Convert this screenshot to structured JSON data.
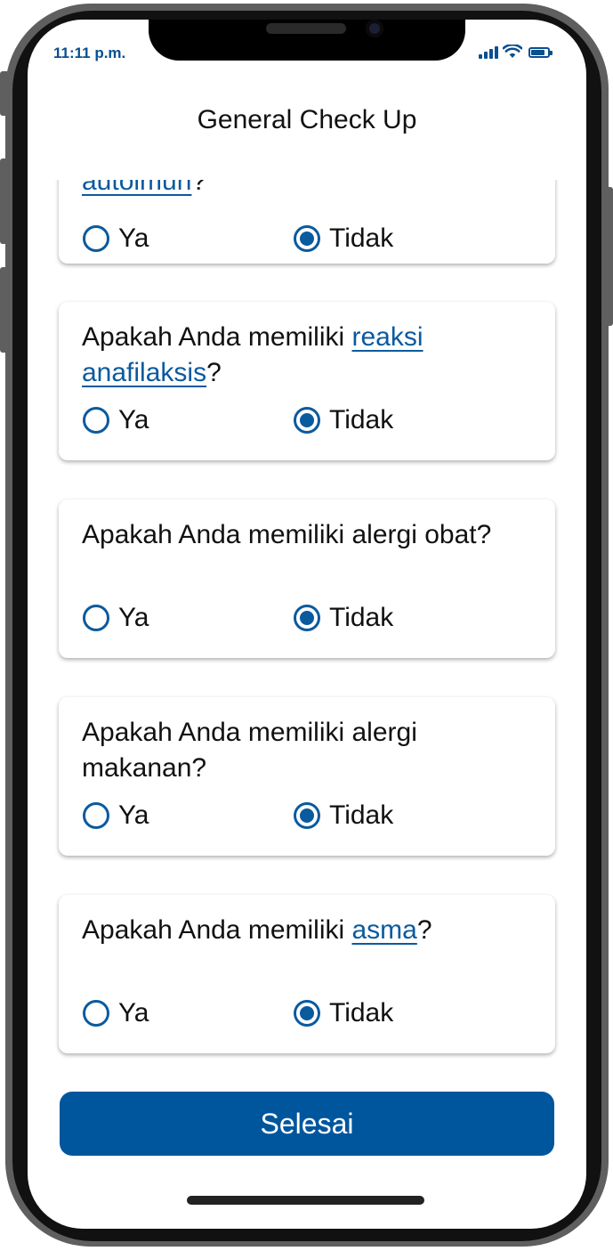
{
  "status_bar": {
    "time": "11:11 p.m.",
    "icons": [
      "cellular-signal-icon",
      "wifi-icon",
      "battery-icon"
    ],
    "color": "#0a4f8f"
  },
  "header": {
    "title": "General Check Up"
  },
  "questions": [
    {
      "parts": [
        "",
        "autoimun",
        "?"
      ],
      "link": "autoimun",
      "options": [
        "Ya",
        "Tidak"
      ],
      "selected": "Tidak",
      "clipped": true
    },
    {
      "parts": [
        "Apakah Anda memiliki ",
        "reaksi anafilaksis",
        "?"
      ],
      "link": "reaksi anafilaksis",
      "options": [
        "Ya",
        "Tidak"
      ],
      "selected": "Tidak"
    },
    {
      "parts": [
        "Apakah Anda memiliki alergi obat?",
        "",
        ""
      ],
      "options": [
        "Ya",
        "Tidak"
      ],
      "selected": "Tidak"
    },
    {
      "parts": [
        "Apakah Anda memiliki alergi makanan?",
        "",
        ""
      ],
      "options": [
        "Ya",
        "Tidak"
      ],
      "selected": "Tidak"
    },
    {
      "parts": [
        "Apakah Anda memiliki ",
        "asma",
        "?"
      ],
      "link": "asma",
      "options": [
        "Ya",
        "Tidak"
      ],
      "selected": "Tidak"
    }
  ],
  "footer": {
    "submit_label": "Selesai"
  },
  "colors": {
    "accent": "#00569d",
    "link": "#0a5a9e",
    "text": "#111111"
  }
}
